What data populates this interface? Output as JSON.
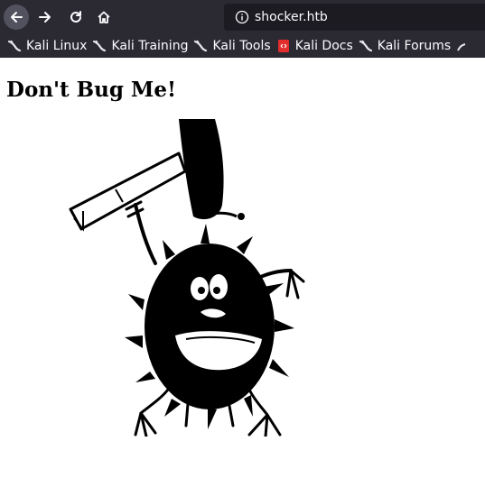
{
  "browser": {
    "url": "shocker.htb"
  },
  "bookmarks": [
    {
      "label": "Kali Linux",
      "icon": "kali-dragon-icon"
    },
    {
      "label": "Kali Training",
      "icon": "kali-dragon-icon"
    },
    {
      "label": "Kali Tools",
      "icon": "kali-dragon-icon"
    },
    {
      "label": "Kali Docs",
      "icon": "kali-docs-icon"
    },
    {
      "label": "Kali Forums",
      "icon": "kali-dragon-icon"
    }
  ],
  "page": {
    "heading": "Don't Bug Me!",
    "image": "cartoon-bug-hammer-image"
  },
  "colors": {
    "toolbar_bg": "#2b2a33",
    "urlbar_bg": "#1c1b22",
    "text_light": "#fbfbfe",
    "docs_icon": "#e22d2d"
  }
}
